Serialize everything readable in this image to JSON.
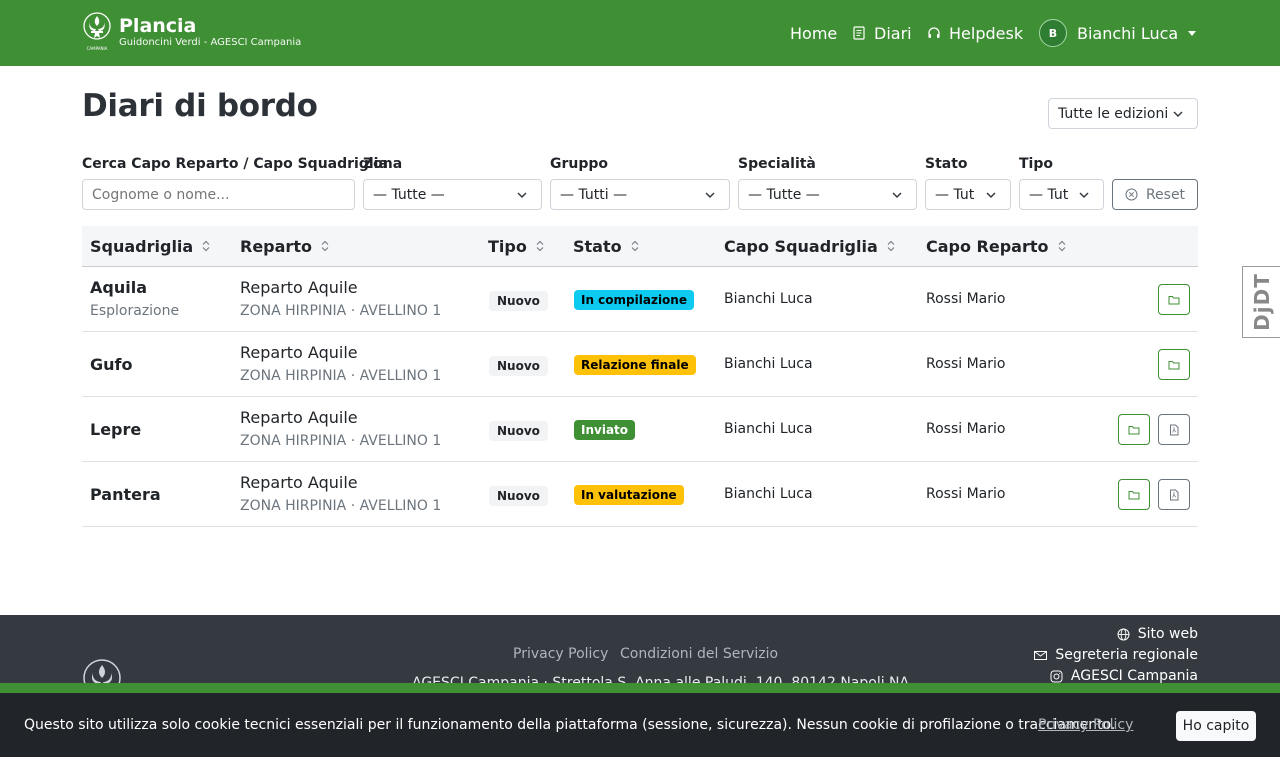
{
  "brand": {
    "title": "Plancia",
    "subtitle": "Guidoncini Verdi - AGESCI Campania",
    "logo_text": "CAMPANIA"
  },
  "nav": {
    "home": "Home",
    "diari": "Diari",
    "helpdesk": "Helpdesk",
    "user_initial": "B",
    "user_name": "Bianchi Luca"
  },
  "page": {
    "title": "Diari di bordo",
    "edition_select": "Tutte le edizioni"
  },
  "filters": {
    "search": {
      "label": "Cerca Capo Reparto / Capo Squadriglia",
      "placeholder": "Cognome o nome..."
    },
    "zona": {
      "label": "Zona",
      "value": "— Tutte —"
    },
    "gruppo": {
      "label": "Gruppo",
      "value": "— Tutti —"
    },
    "specialita": {
      "label": "Specialità",
      "value": "— Tutte —"
    },
    "stato": {
      "label": "Stato",
      "value": "— Tut"
    },
    "tipo": {
      "label": "Tipo",
      "value": "— Tut"
    },
    "reset": "Reset"
  },
  "table": {
    "headers": [
      "Squadriglia",
      "Reparto",
      "Tipo",
      "Stato",
      "Capo Squadriglia",
      "Capo Reparto"
    ],
    "rows": [
      {
        "squadriglia": "Aquila",
        "specialita": "Esplorazione",
        "reparto": "Reparto Aquile",
        "zona": "ZONA HIRPINIA · AVELLINO 1",
        "tipo": "Nuovo",
        "stato": "In compilazione",
        "stato_bg": "#0dcaf0",
        "stato_fg": "#000000",
        "capo_squadriglia": "Bianchi Luca",
        "capo_reparto": "Rossi Mario",
        "pdf": false
      },
      {
        "squadriglia": "Gufo",
        "specialita": "",
        "reparto": "Reparto Aquile",
        "zona": "ZONA HIRPINIA · AVELLINO 1",
        "tipo": "Nuovo",
        "stato": "Relazione finale",
        "stato_bg": "#ffc107",
        "stato_fg": "#000000",
        "capo_squadriglia": "Bianchi Luca",
        "capo_reparto": "Rossi Mario",
        "pdf": false
      },
      {
        "squadriglia": "Lepre",
        "specialita": "",
        "reparto": "Reparto Aquile",
        "zona": "ZONA HIRPINIA · AVELLINO 1",
        "tipo": "Nuovo",
        "stato": "Inviato",
        "stato_bg": "#3f8f35",
        "stato_fg": "#ffffff",
        "capo_squadriglia": "Bianchi Luca",
        "capo_reparto": "Rossi Mario",
        "pdf": true
      },
      {
        "squadriglia": "Pantera",
        "specialita": "",
        "reparto": "Reparto Aquile",
        "zona": "ZONA HIRPINIA · AVELLINO 1",
        "tipo": "Nuovo",
        "stato": "In valutazione",
        "stato_bg": "#ffc107",
        "stato_fg": "#000000",
        "capo_squadriglia": "Bianchi Luca",
        "capo_reparto": "Rossi Mario",
        "pdf": true
      }
    ]
  },
  "debug_toolbar": "DjDT",
  "footer": {
    "privacy": "Privacy Policy",
    "terms": "Condizioni del Servizio",
    "address": "AGESCI Campania · Strettola S. Anna alle Paludi, 140, 80142 Napoli NA",
    "sito_web": "Sito web",
    "segreteria": "Segreteria regionale",
    "instagram": "AGESCI Campania"
  },
  "cookie": {
    "text": "Questo sito utilizza solo cookie tecnici essenziali per il funzionamento della piattaforma (sessione, sicurezza). Nessun cookie di profilazione o tracciamento.",
    "link": "Privacy Policy",
    "button": "Ho capito"
  },
  "colors": {
    "primary": "#3f8f35",
    "footer": "#343a40",
    "cookie_bar": "#212529"
  }
}
